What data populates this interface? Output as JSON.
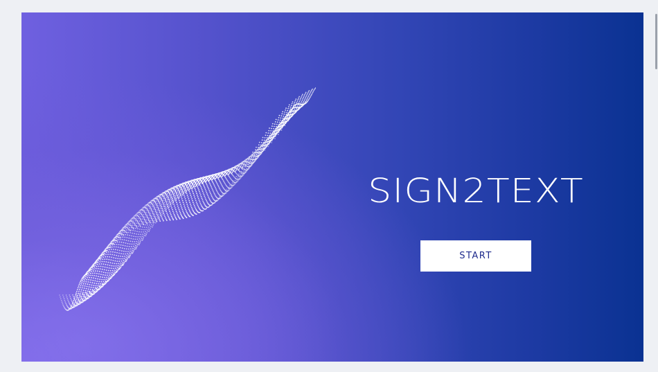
{
  "hero": {
    "title": "SIGN2TEXT",
    "start_label": "START",
    "colors": {
      "gradient_left": "#6f60e0",
      "gradient_right": "#0a3292",
      "button_bg": "#ffffff",
      "button_text": "#1e2a8c"
    },
    "decoration_icon": "particle-wave-icon"
  }
}
